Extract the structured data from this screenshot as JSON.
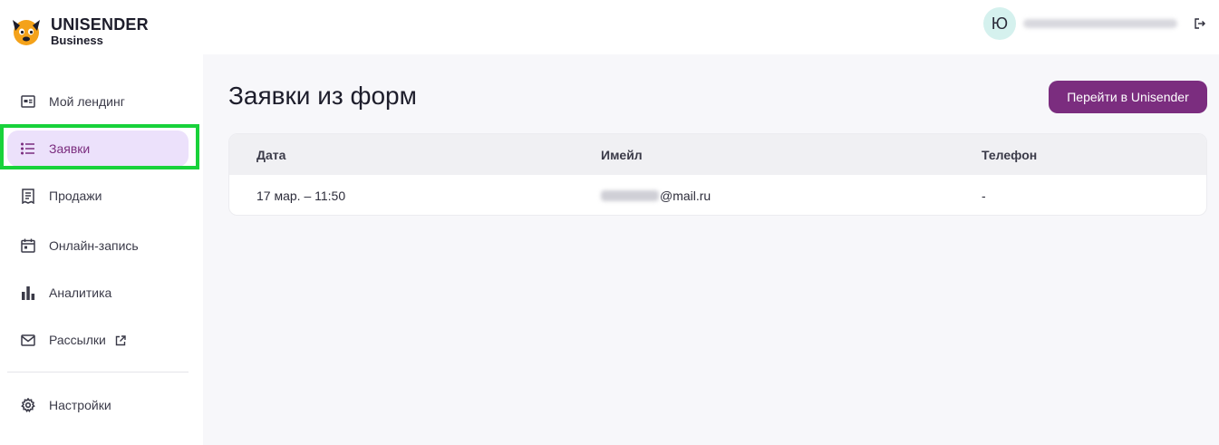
{
  "brand": {
    "title": "UNISENDER",
    "subtitle": "Business"
  },
  "user": {
    "initial": "Ю",
    "logout_icon": "logout-icon"
  },
  "sidebar": {
    "items": [
      {
        "label": "Мой лендинг",
        "icon": "landing-icon"
      },
      {
        "label": "Заявки",
        "icon": "list-icon",
        "active": true
      },
      {
        "label": "Продажи",
        "icon": "receipt-icon"
      },
      {
        "label": "Онлайн-запись",
        "icon": "calendar-icon"
      },
      {
        "label": "Аналитика",
        "icon": "bar-chart-icon"
      },
      {
        "label": "Рассылки",
        "icon": "mail-icon",
        "external": true
      },
      {
        "label": "Настройки",
        "icon": "gear-icon"
      }
    ]
  },
  "main": {
    "title": "Заявки из форм",
    "cta_label": "Перейти в Unisender",
    "table": {
      "columns": [
        "Дата",
        "Имейл",
        "Телефон"
      ],
      "rows": [
        {
          "date": "17 мар. – 11:50",
          "email_suffix": "@mail.ru",
          "phone": "-"
        }
      ]
    }
  },
  "colors": {
    "accent": "#7b2d7f",
    "active_bg": "#ece1fb",
    "highlight": "#18d23a",
    "avatar_bg": "#d5f1ee"
  }
}
